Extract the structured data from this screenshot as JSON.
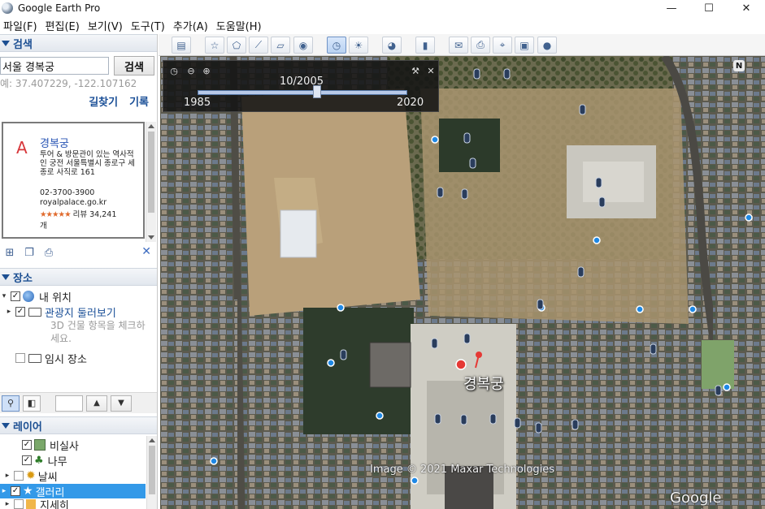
{
  "window": {
    "title": "Google Earth Pro",
    "minimize": "—",
    "maximize": "☐",
    "close": "✕"
  },
  "menu": [
    "파일(F)",
    "편집(E)",
    "보기(V)",
    "도구(T)",
    "추가(A)",
    "도움말(H)"
  ],
  "search": {
    "header": "검색",
    "value": "서울 경복궁",
    "button": "검색",
    "hint": "예: 37.407229, -122.107162",
    "links": [
      "길찾기",
      "기록"
    ],
    "result": {
      "letter": "A",
      "title": "경복궁",
      "description": "투어 & 방문관이 있는 역사적인 궁전 서울특별시 종로구 세종로 사직로 161",
      "phone": "02-3700-3900",
      "url": "royalpalace.go.kr",
      "stars": "★★★★★",
      "rating": "리뷰 34,241",
      "rating_suffix": "개"
    }
  },
  "places": {
    "header": "장소",
    "items": [
      {
        "label": "내 위치"
      },
      {
        "label": "관광지 둘러보기",
        "note": "3D 건물 항목을 체크하세요."
      },
      {
        "label": "임시 장소"
      }
    ]
  },
  "layers": {
    "header": "레이어",
    "items": [
      {
        "label": "비실사"
      },
      {
        "label": "나무"
      },
      {
        "label": "날씨"
      },
      {
        "label": "갤러리"
      },
      {
        "label": "지세히"
      }
    ]
  },
  "timeslider": {
    "current": "10/2005",
    "start": "1985",
    "end": "2020",
    "position": 0.57
  },
  "map": {
    "place_label": "경복궁",
    "copyright": "Image © 2021 Maxar Technologies",
    "brand": "Google Earth",
    "compass": "N"
  },
  "colors": {
    "accent": "#1c4f92",
    "link": "#1a4f97",
    "selected": "#3399e8",
    "result_letter": "#d7373b"
  }
}
